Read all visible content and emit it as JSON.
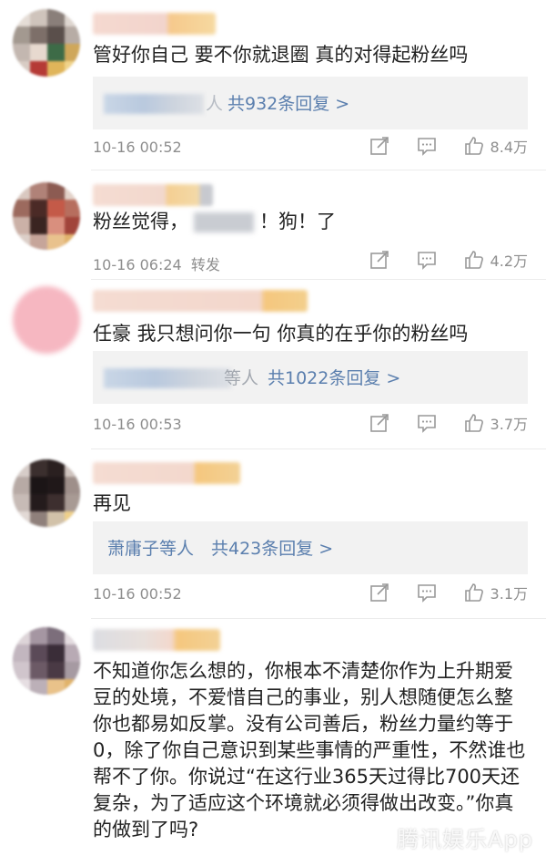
{
  "colors": {
    "link": "#5b7fae",
    "meta": "#8e8e8e",
    "text": "#222222",
    "reply_bg": "#f2f2f2"
  },
  "comments": [
    {
      "text": "管好你自己 要不你就退圈 真的对得起粉丝吗",
      "reply_suffix": "人",
      "reply_count": "共932条回复 >",
      "time": "10-16 00:52",
      "likes": "8.4万"
    },
    {
      "text_before": "粉丝觉得，",
      "text_after": "！狗！了",
      "time": "10-16 06:24",
      "forward": "转发",
      "likes": "4.2万"
    },
    {
      "text": "任豪 我只想问你一句  你真的在乎你的粉丝吗",
      "reply_suffix": "等人",
      "reply_count": "共1022条回复 >",
      "time": "10-16 00:53",
      "likes": "3.7万"
    },
    {
      "text": "再见",
      "reply_names": "萧庸子等人",
      "reply_count": "共423条回复 >",
      "time": "10-16 00:52",
      "likes": "3.1万"
    },
    {
      "text": "不知道你怎么想的，你根本不清楚你作为上升期爱豆的处境，不爱惜自己的事业，别人想随便怎么整你也都易如反掌。没有公司善后，粉丝力量约等于0，除了你自己意识到某些事情的严重性，不然谁也帮不了你。你说过“在这行业365天过得比700天还复杂，为了适应这个环境就必须得做出改变。”你真的做到了吗?"
    }
  ],
  "icons": [
    "share-icon",
    "comment-icon",
    "like-icon"
  ],
  "watermark": "腾讯娱乐App"
}
